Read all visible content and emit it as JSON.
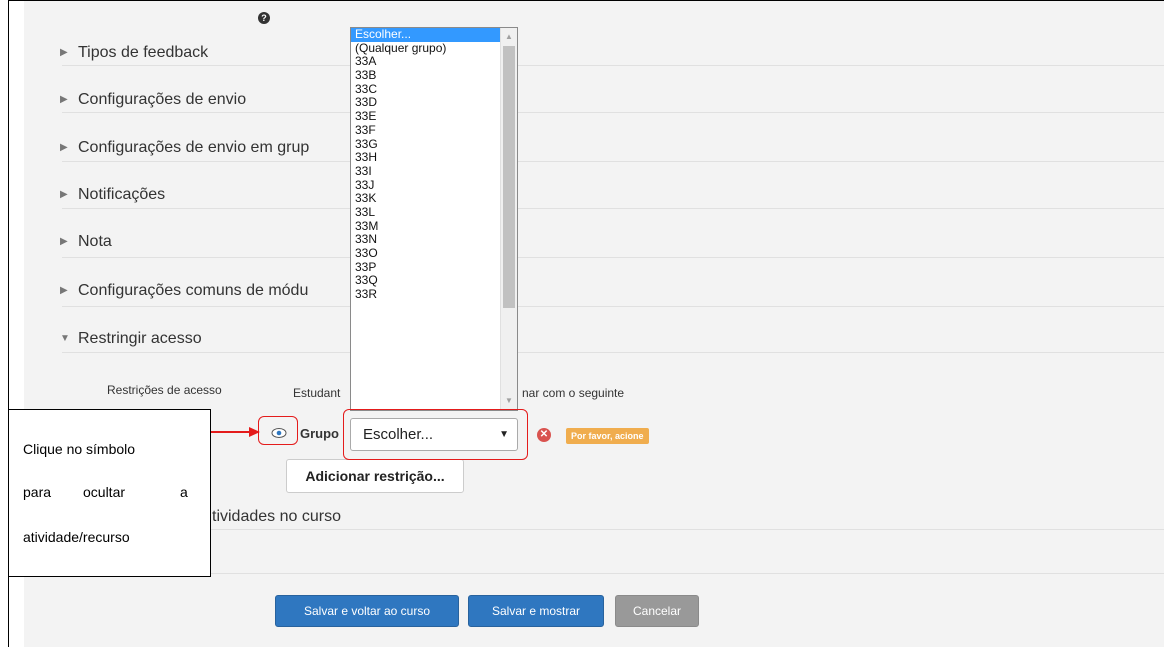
{
  "sections": [
    {
      "label": "Tipos de feedback"
    },
    {
      "label": "Configurações de envio"
    },
    {
      "label": "Configurações de envio em grup"
    },
    {
      "label": "Notificações"
    },
    {
      "label": "Nota"
    },
    {
      "label": "Configurações comuns de módu"
    },
    {
      "label": "Restringir acesso"
    }
  ],
  "restrict": {
    "label": "Restrições de acesso",
    "student_text": "Estudant",
    "condition_suffix": "nar com o seguinte",
    "group_label": "Grupo",
    "select_value": "Escolher...",
    "badge": "Por favor, acione",
    "add_button": "Adicionar restrição..."
  },
  "activities_label": "tividades no curso",
  "dropdown": {
    "options": [
      "Escolher...",
      "(Qualquer grupo)",
      "33A",
      "33B",
      "33C",
      "33D",
      "33E",
      "33F",
      "33G",
      "33H",
      "33I",
      "33J",
      "33K",
      "33L",
      "33M",
      "33N",
      "33O",
      "33P",
      "33Q",
      "33R"
    ]
  },
  "buttons": {
    "save_return": "Salvar e voltar ao curso",
    "save_show": "Salvar e mostrar",
    "cancel": "Cancelar"
  },
  "callout": {
    "line1": "Clique no símbolo",
    "line2a": "para",
    "line2b": "ocultar",
    "line2c": "a",
    "line3": "atividade/recurso"
  },
  "colors": {
    "primary": "#2f77c0",
    "highlight": "#e41b1b",
    "badge": "#f0ad4e",
    "selection": "#3399ff"
  }
}
